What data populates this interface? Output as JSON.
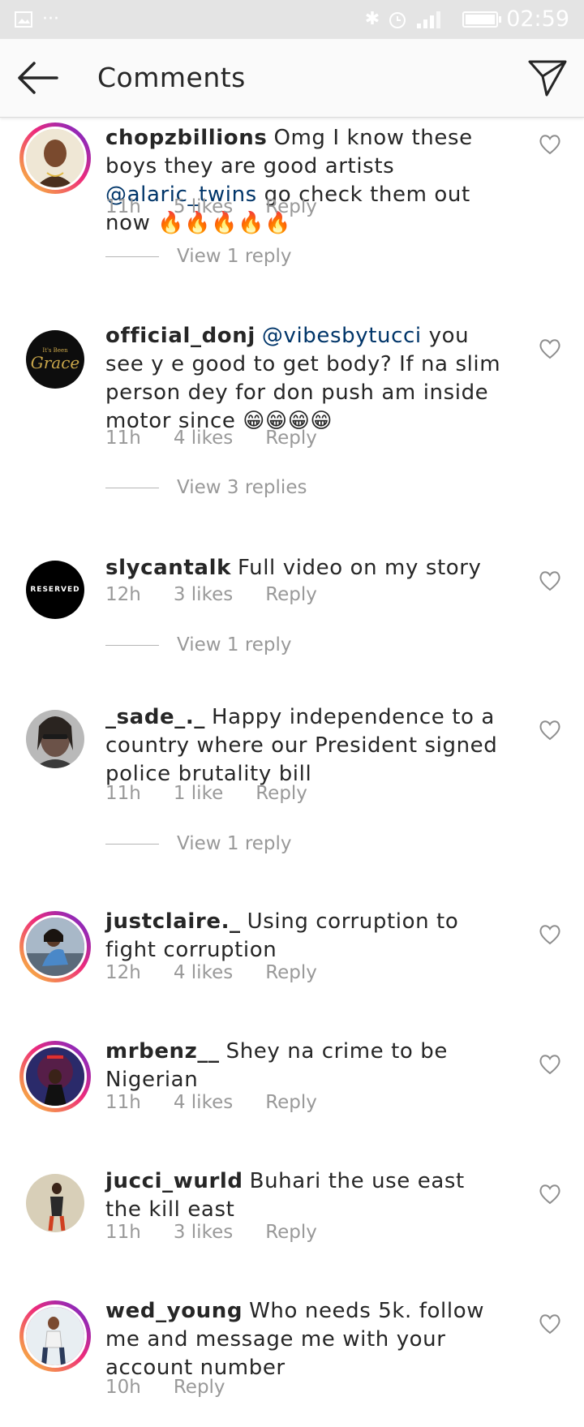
{
  "status_bar": {
    "time": "02:59",
    "left_icons": [
      "image-icon",
      "more-icon"
    ],
    "right_icons": [
      "bluetooth-icon",
      "alarm-icon",
      "signal-icon",
      "battery-icon"
    ]
  },
  "header": {
    "title": "Comments"
  },
  "comments": [
    {
      "username": "chopzbillions",
      "text_before": "Omg I know these boys they are good artists ",
      "mention": "@alaric_twins",
      "text_after": " go check them out now 🔥🔥🔥🔥🔥",
      "time": "11h",
      "likes": "5 likes",
      "reply": "Reply",
      "view_replies": "View 1 reply"
    },
    {
      "username": "official_donj",
      "text_before": "",
      "mention": "@vibesbytucci",
      "text_after": "  you see y e good to get body? If na slim person dey for don push am inside motor since 😁😁😁😁",
      "time": "11h",
      "likes": "4 likes",
      "reply": "Reply",
      "view_replies": "View 3 replies",
      "avatar_text_small": "It's Been",
      "avatar_text": "Grace"
    },
    {
      "username": "slycantalk",
      "text_before": "Full video on my story",
      "mention": "",
      "text_after": "",
      "time": "12h",
      "likes": "3 likes",
      "reply": "Reply",
      "view_replies": "View 1 reply",
      "avatar_text": "RESERVED"
    },
    {
      "username": "_sade_._",
      "text_before": "Happy independence to a country where our President signed police brutality bill",
      "mention": "",
      "text_after": "",
      "time": "11h",
      "likes": "1 like",
      "reply": "Reply",
      "view_replies": "View 1 reply"
    },
    {
      "username": "justclaire._",
      "text_before": "Using corruption to fight corruption",
      "mention": "",
      "text_after": "",
      "time": "12h",
      "likes": "4 likes",
      "reply": "Reply"
    },
    {
      "username": "mrbenz__",
      "text_before": "Shey na crime to be Nigerian",
      "mention": "",
      "text_after": "",
      "time": "11h",
      "likes": "4 likes",
      "reply": "Reply"
    },
    {
      "username": "jucci_wurld",
      "text_before": "Buhari the use east the kill east",
      "mention": "",
      "text_after": "",
      "time": "11h",
      "likes": "3 likes",
      "reply": "Reply"
    },
    {
      "username": "wed_young",
      "text_before": "Who needs 5k. follow me and message me with your account number",
      "mention": "",
      "text_after": "",
      "time": "10h",
      "likes": "",
      "reply": "Reply"
    }
  ]
}
